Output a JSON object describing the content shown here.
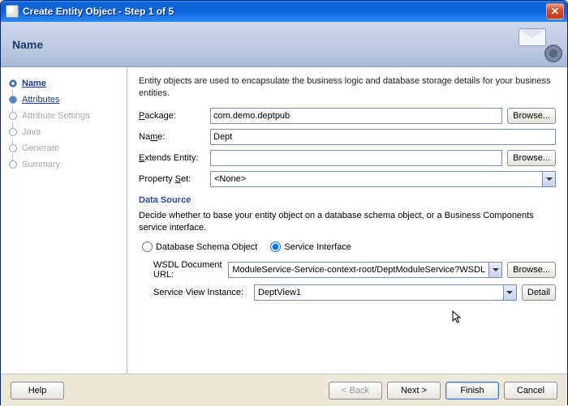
{
  "window": {
    "title": "Create Entity Object - Step 1 of 5"
  },
  "banner": {
    "heading": "Name"
  },
  "steps": [
    {
      "label": "Name"
    },
    {
      "label": "Attributes"
    },
    {
      "label": "Attribute Settings"
    },
    {
      "label": "Java"
    },
    {
      "label": "Generate"
    },
    {
      "label": "Summary"
    }
  ],
  "intro": "Entity objects are used to encapsulate the business logic and database storage details for your business entities.",
  "fields": {
    "package_label": "Package:",
    "package_value": "com.demo.deptpub",
    "name_label": "Name:",
    "name_value": "Dept",
    "extends_label": "Extends Entity:",
    "extends_value": "",
    "propset_label": "Property Set:",
    "propset_value": "<None>",
    "browse": "Browse..."
  },
  "datasource": {
    "title": "Data Source",
    "decide": "Decide whether to base your entity object on a database schema object, or a Business Components service interface.",
    "radio_db": "Database Schema Object",
    "radio_svc": "Service Interface",
    "wsdl_label": "WSDL Document URL:",
    "wsdl_value": "ModuleService-Service-context-root/DeptModuleService?WSDL",
    "svi_label": "Service View Instance:",
    "svi_value": "DeptView1",
    "browse": "Browse...",
    "detail": "Detail"
  },
  "footer": {
    "help": "Help",
    "back": "< Back",
    "next": "Next >",
    "finish": "Finish",
    "cancel": "Cancel"
  }
}
